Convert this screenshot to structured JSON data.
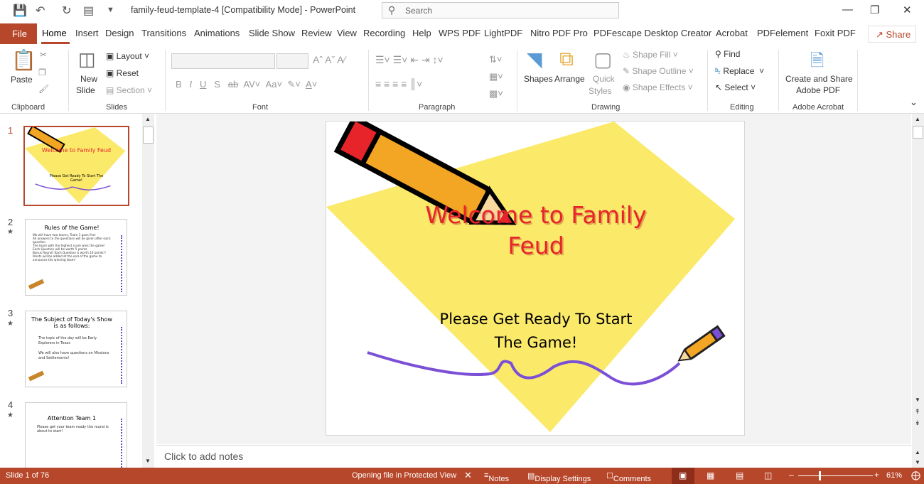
{
  "window": {
    "title": "family-feud-template-4 [Compatibility Mode]  -  PowerPoint",
    "search_placeholder": "Search"
  },
  "tabs": [
    "File",
    "Home",
    "Insert",
    "Design",
    "Transitions",
    "Animations",
    "Slide Show",
    "Review",
    "View",
    "Recording",
    "Help",
    "WPS PDF",
    "LightPDF",
    "Nitro PDF Pro",
    "PDFescape Desktop Creator",
    "Acrobat",
    "PDFelement",
    "Foxit PDF"
  ],
  "share_label": "Share",
  "ribbon": {
    "clipboard": {
      "paste": "Paste",
      "group": "Clipboard"
    },
    "slides": {
      "new_slide": "New",
      "new_slide2": "Slide",
      "layout": "Layout",
      "reset": "Reset",
      "section": "Section",
      "group": "Slides"
    },
    "font": {
      "group": "Font",
      "buttons": [
        "B",
        "I",
        "U",
        "S",
        "ab",
        "AV",
        "Aa"
      ]
    },
    "paragraph": {
      "group": "Paragraph"
    },
    "drawing": {
      "shapes": "Shapes",
      "arrange": "Arrange",
      "quick_styles": "Quick",
      "quick_styles2": "Styles",
      "shape_fill": "Shape Fill",
      "shape_outline": "Shape Outline",
      "shape_effects": "Shape Effects",
      "group": "Drawing"
    },
    "editing": {
      "find": "Find",
      "replace": "Replace",
      "select": "Select",
      "group": "Editing"
    },
    "acrobat": {
      "create1": "Create and Share",
      "create2": "Adobe PDF",
      "group": "Adobe Acrobat"
    }
  },
  "thumbnails": [
    {
      "num": "1",
      "title": "Welcome to Family Feud",
      "body": "Please Get Ready To Start The Game!"
    },
    {
      "num": "2",
      "title": "Rules of the Game!",
      "bullets": [
        "We will have two teams, Team 1 goes first",
        "All answers to the questions will be given after each question",
        "The team with the highest score wins the game!",
        "Each Question will be worth 5 points",
        "Bonus Round! Each Question is worth 10 points!!",
        "Points will be added at the end of the game to announce the winning team!"
      ]
    },
    {
      "num": "3",
      "title": "The Subject of Today's Show is as follows:",
      "bullets": [
        "The topic of the day will be Early Explorers in Texas",
        "We will also have questions on Missions and Settlements!"
      ]
    },
    {
      "num": "4",
      "title": "Attention Team 1",
      "bullets": [
        "Please get your team ready the round is about to start!"
      ]
    }
  ],
  "slide": {
    "title_line1": "Welcome to Family",
    "title_line2": "Feud",
    "subtitle_line1": "Please Get Ready To Start",
    "subtitle_line2": "The Game!",
    "colors": {
      "diamond": "#fbe96a",
      "title": "#e8242b",
      "wave": "#7b4fd6"
    }
  },
  "notes_placeholder": "Click to add notes",
  "status": {
    "slide": "Slide 1 of 76",
    "protected": "Opening file in Protected View",
    "notes": "Notes",
    "display": "Display Settings",
    "comments": "Comments",
    "zoom": "61%",
    "zoom_value": 61
  },
  "accent": "#b7472a"
}
